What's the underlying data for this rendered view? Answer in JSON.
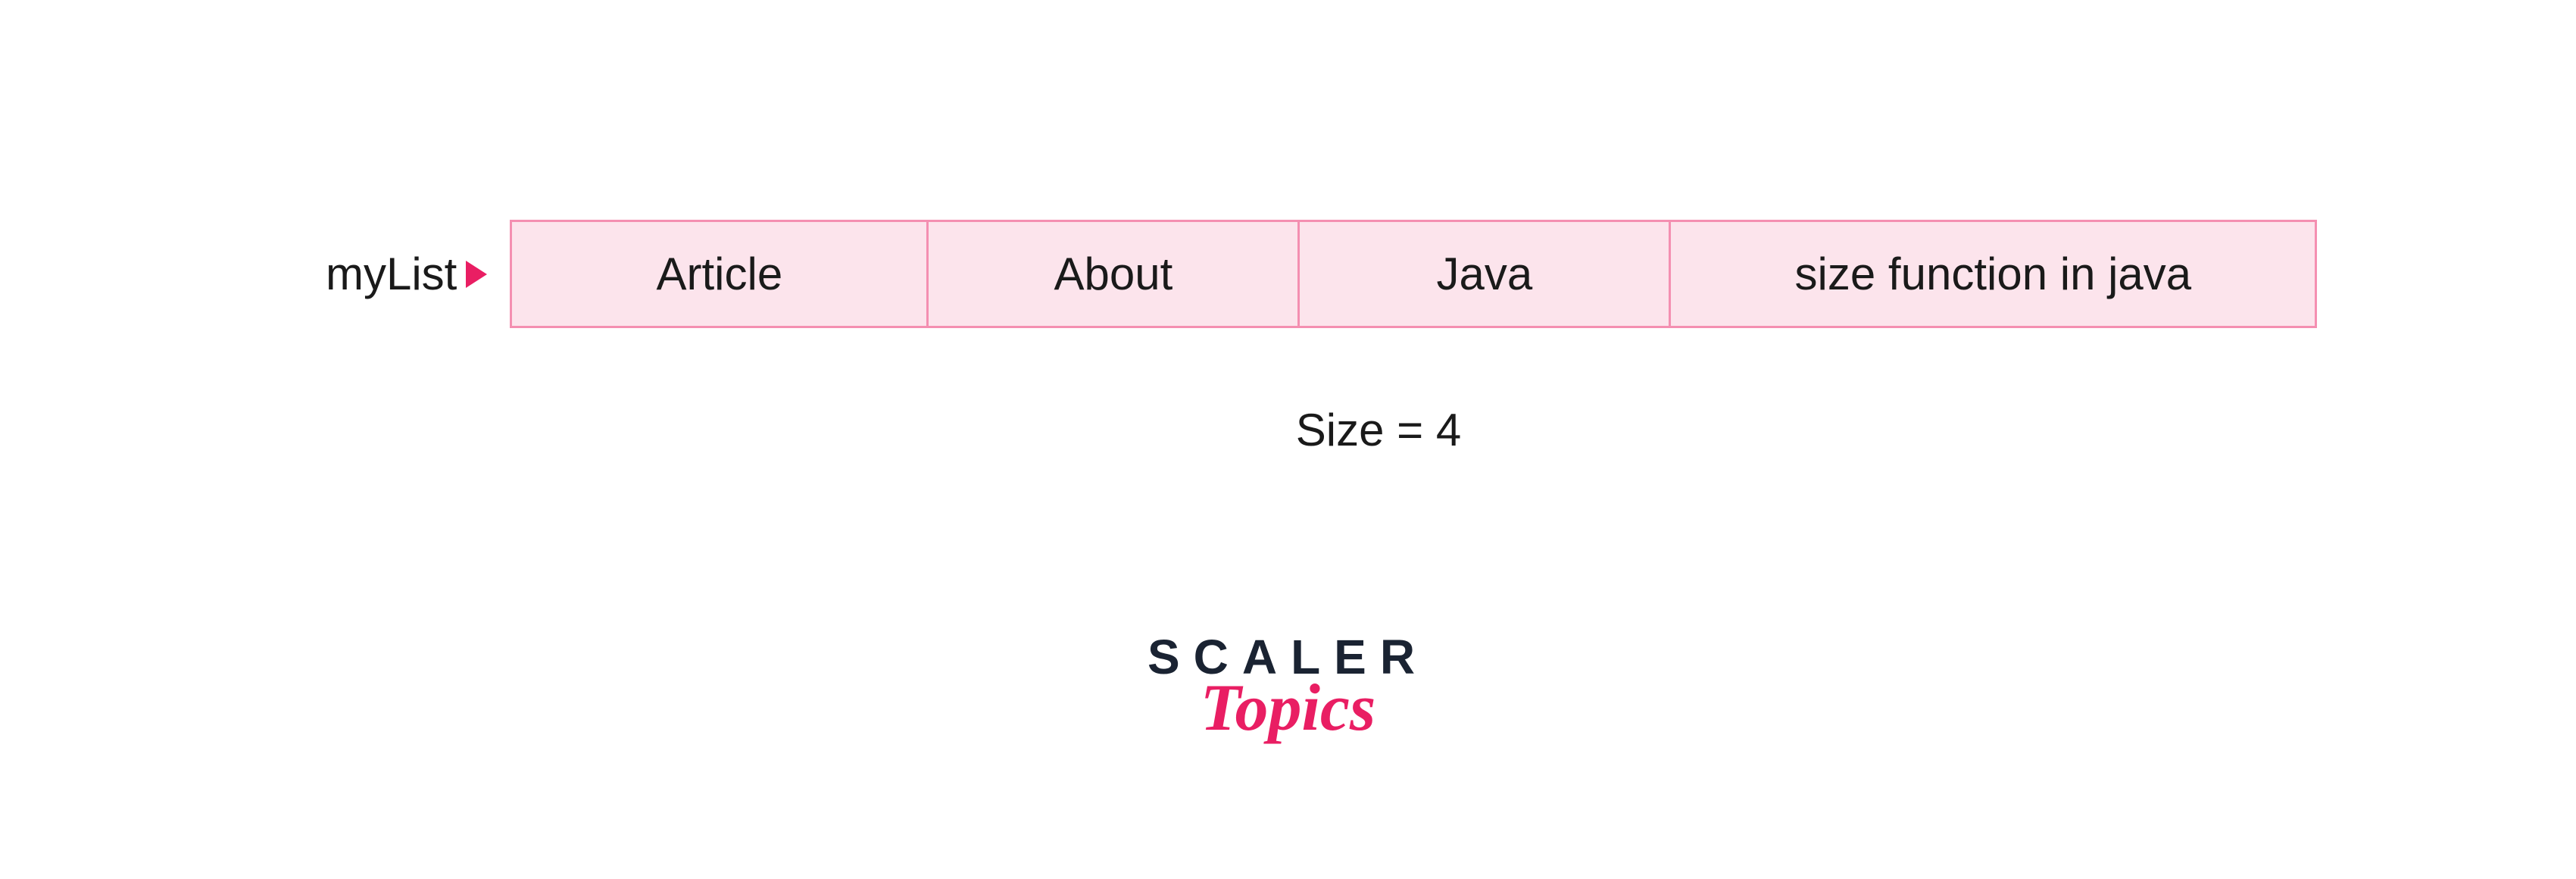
{
  "diagram": {
    "listLabel": "myList",
    "cells": [
      "Article",
      "About",
      "Java",
      "size function in java"
    ],
    "sizeLabel": "Size = 4"
  },
  "logo": {
    "line1": "SCALER",
    "line2": "Topics"
  }
}
